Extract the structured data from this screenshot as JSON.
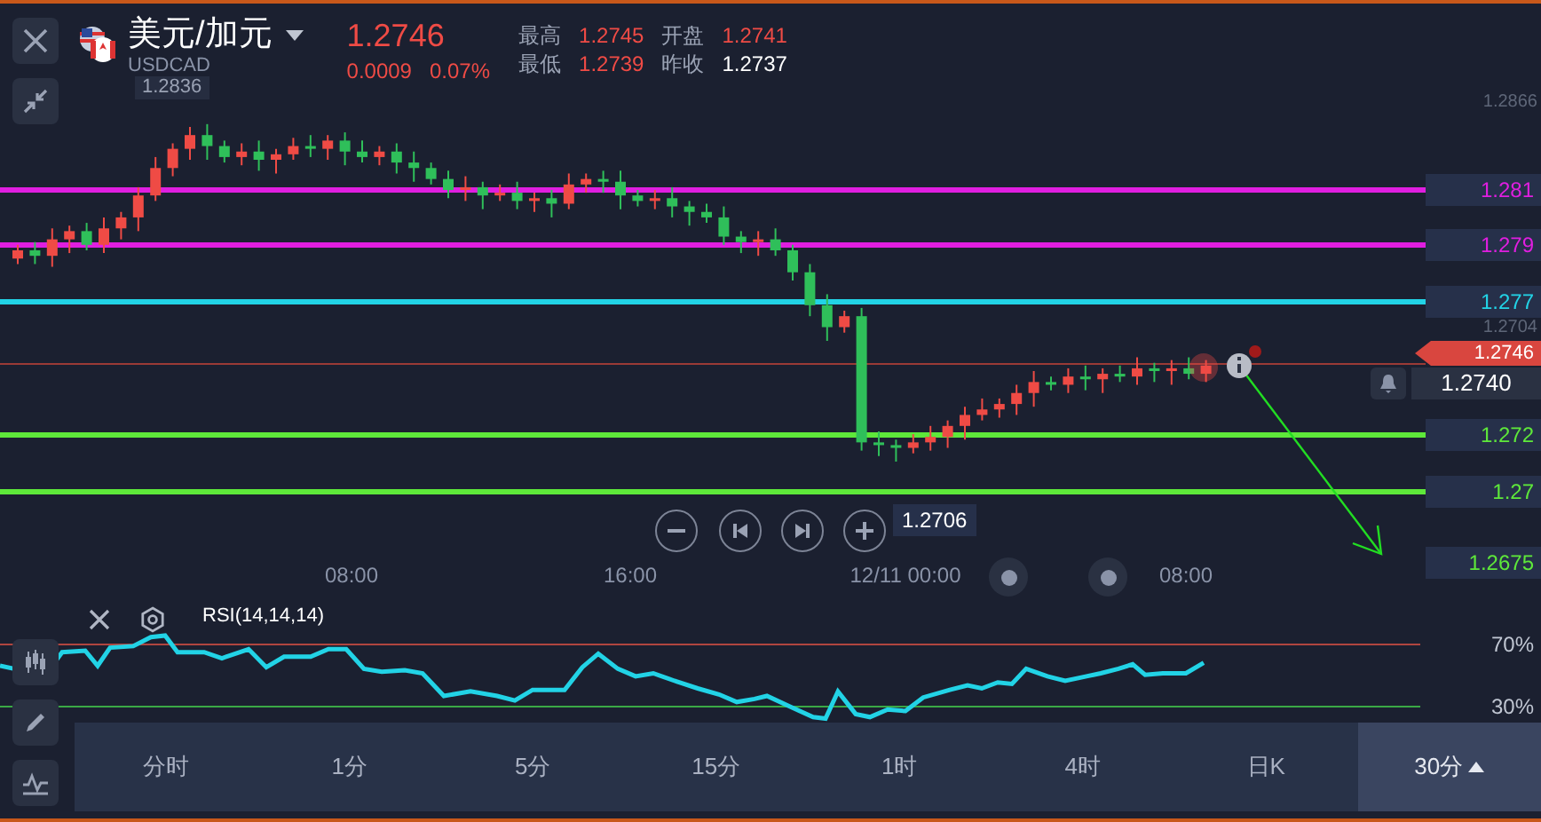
{
  "header": {
    "pair": "美元/加元",
    "symbol": "USDCAD",
    "price": "1.2746",
    "change": "0.0009",
    "change_pct": "0.07%",
    "stats": [
      {
        "label": "最高",
        "value": "1.2745",
        "kind": "up"
      },
      {
        "label": "开盘",
        "value": "1.2741",
        "kind": "up"
      },
      {
        "label": "最低",
        "value": "1.2739",
        "kind": "up"
      },
      {
        "label": "昨收",
        "value": "1.2737",
        "kind": "flat"
      }
    ]
  },
  "chart": {
    "max_label": "1.2836",
    "min_label": "1.2706",
    "axis_labels": [
      "1.2866",
      "1.2704"
    ],
    "levels": [
      {
        "label": "1.281",
        "color": "#e01ee0"
      },
      {
        "label": "1.279",
        "color": "#e01ee0"
      },
      {
        "label": "1.277",
        "color": "#22d3e6"
      },
      {
        "label": "1.272",
        "color": "#5ee83a"
      },
      {
        "label": "1.27",
        "color": "#5ee83a"
      }
    ],
    "target_label": "1.2675",
    "last_price": "1.2746",
    "crosshair_price": "1.2740"
  },
  "time_axis": [
    "08:00",
    "16:00",
    "12/11 00:00",
    "08:00"
  ],
  "rsi": {
    "label": "RSI(14,14,14)",
    "upper": "70%",
    "lower": "30%"
  },
  "periods": [
    {
      "label": "分时",
      "selected": false
    },
    {
      "label": "1分",
      "selected": false
    },
    {
      "label": "5分",
      "selected": false
    },
    {
      "label": "15分",
      "selected": false
    },
    {
      "label": "1时",
      "selected": false
    },
    {
      "label": "4时",
      "selected": false
    },
    {
      "label": "日K",
      "selected": false
    },
    {
      "label": "30分",
      "selected": true
    }
  ]
}
